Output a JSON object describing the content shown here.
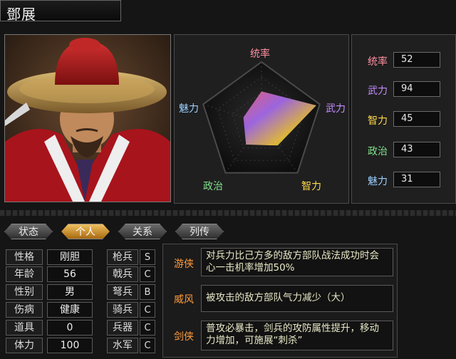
{
  "character": {
    "name": "鄧展"
  },
  "radar": {
    "labels": {
      "top": "统率",
      "right": "武力",
      "bottom_right": "智力",
      "bottom_left": "政治",
      "left": "魅力"
    },
    "values": {
      "tongshuai": 52,
      "wuli": 94,
      "zhili": 45,
      "zhengzhi": 43,
      "meili": 31
    },
    "max": 100
  },
  "stats": [
    {
      "label": "统率",
      "value": "52",
      "color": "#ff8fa0"
    },
    {
      "label": "武力",
      "value": "94",
      "color": "#c58cff"
    },
    {
      "label": "智力",
      "value": "45",
      "color": "#ffd84a"
    },
    {
      "label": "政治",
      "value": "43",
      "color": "#7fe08a"
    },
    {
      "label": "魅力",
      "value": "31",
      "color": "#9ad0ff"
    }
  ],
  "tabs": [
    {
      "label": "状态",
      "active": false
    },
    {
      "label": "个人",
      "active": true
    },
    {
      "label": "关系",
      "active": false
    },
    {
      "label": "列传",
      "active": false
    }
  ],
  "personal": [
    {
      "label": "性格",
      "value": "刚胆"
    },
    {
      "label": "年龄",
      "value": "56"
    },
    {
      "label": "性别",
      "value": "男"
    },
    {
      "label": "伤病",
      "value": "健康"
    },
    {
      "label": "道具",
      "value": "0"
    },
    {
      "label": "体力",
      "value": "100"
    }
  ],
  "aptitudes": [
    {
      "name": "枪兵",
      "grade": "S"
    },
    {
      "name": "戟兵",
      "grade": "C"
    },
    {
      "name": "弩兵",
      "grade": "B"
    },
    {
      "name": "骑兵",
      "grade": "C"
    },
    {
      "name": "兵器",
      "grade": "C"
    },
    {
      "name": "水军",
      "grade": "C"
    }
  ],
  "skills": [
    {
      "name": "游侠",
      "desc": "对兵力比己方多的敌方部队战法成功时会心一击机率增加50%"
    },
    {
      "name": "威风",
      "desc": "被攻击的敌方部队气力减少（大）"
    },
    {
      "name": "剑侠",
      "desc": "普攻必暴击，剑兵的攻防属性提升，移动力增加，可施展“刺杀”"
    }
  ]
}
